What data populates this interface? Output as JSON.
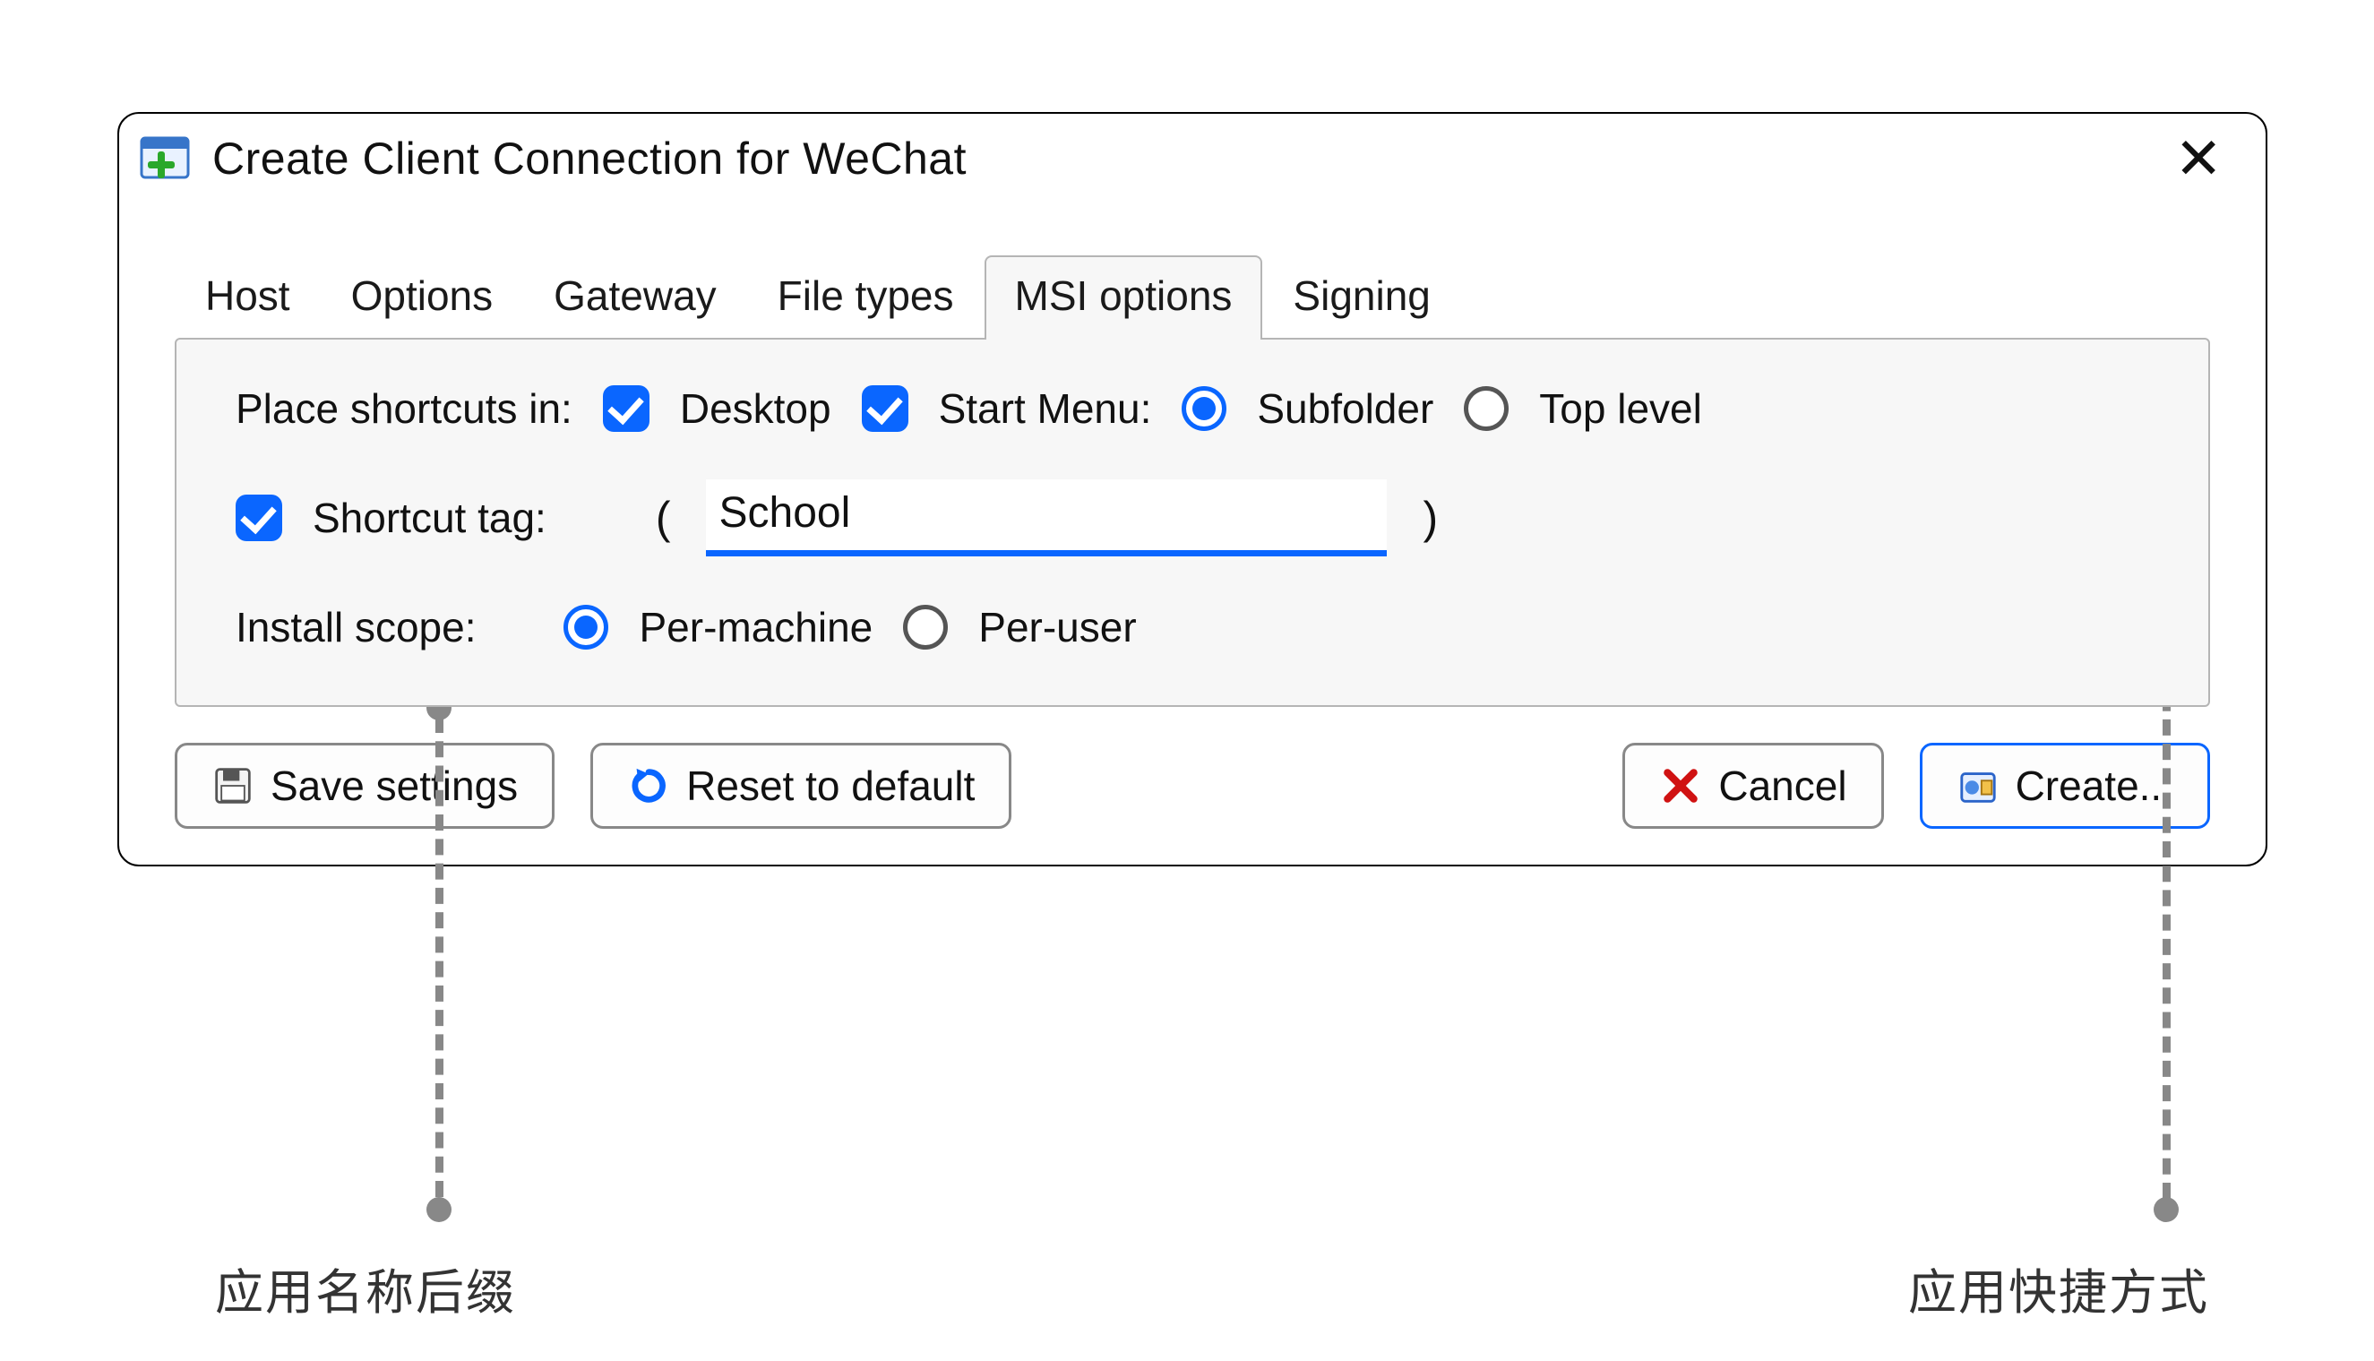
{
  "window": {
    "title": "Create Client Connection for WeChat"
  },
  "tabs": {
    "host": "Host",
    "options": "Options",
    "gateway": "Gateway",
    "filetypes": "File types",
    "msioptions": "MSI options",
    "signing": "Signing",
    "active": "msioptions"
  },
  "panel": {
    "place_label": "Place shortcuts in:",
    "desktop": "Desktop",
    "startmenu": "Start Menu:",
    "subfolder": "Subfolder",
    "toplevel": "Top level",
    "shortcut_tag_label": "Shortcut tag:",
    "shortcut_tag_value": "School",
    "install_scope_label": "Install scope:",
    "per_machine": "Per-machine",
    "per_user": "Per-user",
    "paren_open": "(",
    "paren_close": ")"
  },
  "buttons": {
    "save": "Save settings",
    "reset": "Reset to default",
    "cancel": "Cancel",
    "create": "Create..."
  },
  "annotations": {
    "suffix": "应用名称后缀",
    "shortcut": "应用快捷方式"
  }
}
